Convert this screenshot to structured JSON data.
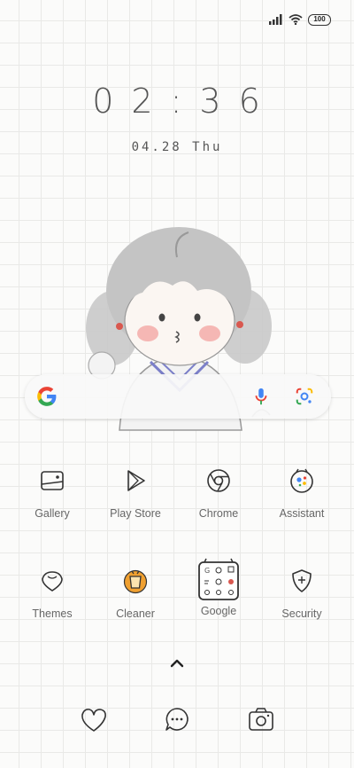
{
  "status_bar": {
    "battery": "100",
    "icons": [
      "signal-icon",
      "wifi-icon",
      "battery-icon"
    ]
  },
  "lockscreen": {
    "time": "02:36",
    "date": "04.28 Thu"
  },
  "search_bar": {
    "icons": [
      "google-g-icon",
      "microphone-icon",
      "google-lens-icon"
    ]
  },
  "apps": [
    {
      "label": "Gallery",
      "icon": "gallery-icon"
    },
    {
      "label": "Play Store",
      "icon": "play-store-icon"
    },
    {
      "label": "Chrome",
      "icon": "chrome-icon"
    },
    {
      "label": "Assistant",
      "icon": "assistant-icon"
    },
    {
      "label": "Themes",
      "icon": "themes-icon"
    },
    {
      "label": "Cleaner",
      "icon": "cleaner-icon"
    },
    {
      "label": "Google",
      "icon": "google-folder-icon"
    },
    {
      "label": "Security",
      "icon": "security-icon"
    }
  ],
  "dock": [
    "heart-icon",
    "chat-bubble-icon",
    "camera-icon"
  ],
  "colors": {
    "background": "#fbfbfa",
    "grid": "#e9e9e7",
    "cheek": "#f4a7a4",
    "sailor_collar": "#7b7fc9",
    "cleaner": "#f0a030"
  }
}
